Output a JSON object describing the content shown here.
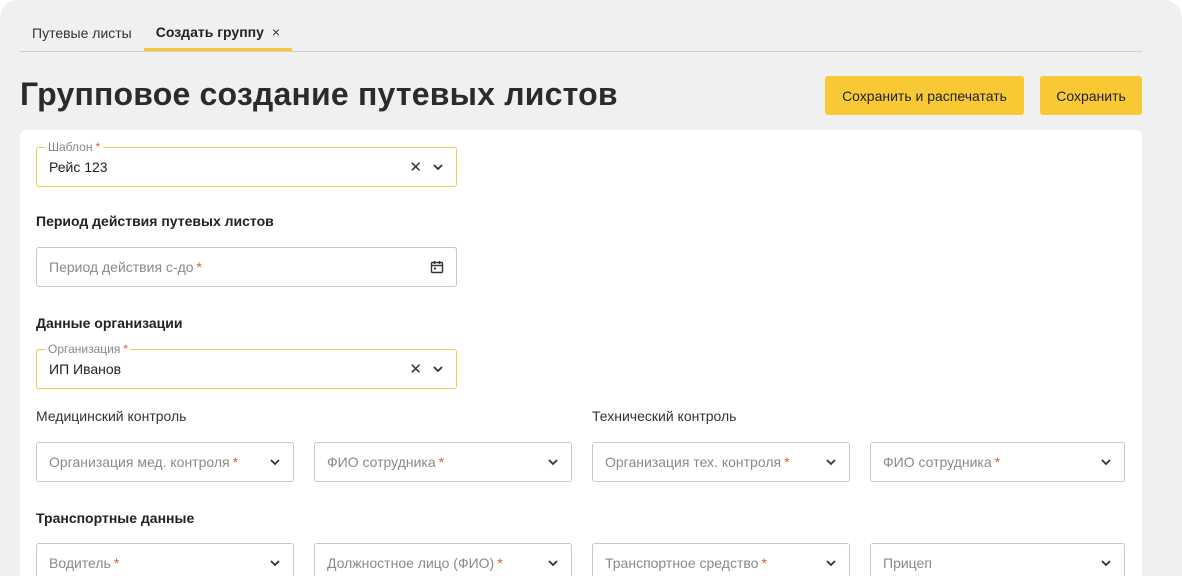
{
  "tabs": [
    {
      "label": "Путевые листы",
      "active": false
    },
    {
      "label": "Создать группу",
      "active": true,
      "close": "×"
    }
  ],
  "page_title": "Групповое создание путевых листов",
  "actions": {
    "save_print_label": "Сохранить и распечатать",
    "save_label": "Сохранить"
  },
  "colors": {
    "accent": "#f8c935",
    "required": "#e2583e",
    "focus_border": "#f1c94a"
  },
  "form": {
    "template": {
      "label": "Шаблон",
      "required": "*",
      "value": "Рейс 123",
      "clear_icon": "clear-icon",
      "dropdown_icon": "chevron-down-icon"
    },
    "period_section": "Период действия путевых листов",
    "period": {
      "placeholder": "Период действия с-до",
      "required": "*",
      "icon": "calendar-icon"
    },
    "org_section": "Данные организации",
    "organization": {
      "label": "Организация",
      "required": "*",
      "value": "ИП Иванов"
    },
    "medical": {
      "title": "Медицинский контроль",
      "org": {
        "placeholder": "Организация мед. контроля",
        "required": "*"
      },
      "employee": {
        "placeholder": "ФИО сотрудника",
        "required": "*"
      }
    },
    "technical": {
      "title": "Технический контроль",
      "org": {
        "placeholder": "Организация тех. контроля",
        "required": "*"
      },
      "employee": {
        "placeholder": "ФИО сотрудника",
        "required": "*"
      }
    },
    "transport_section": "Транспортные данные",
    "transport": {
      "driver": {
        "placeholder": "Водитель",
        "required": "*"
      },
      "official": {
        "placeholder": "Должностное лицо (ФИО)",
        "required": "*"
      },
      "vehicle": {
        "placeholder": "Транспортное средство",
        "required": "*"
      },
      "trailer": {
        "placeholder": "Прицеп"
      }
    }
  }
}
